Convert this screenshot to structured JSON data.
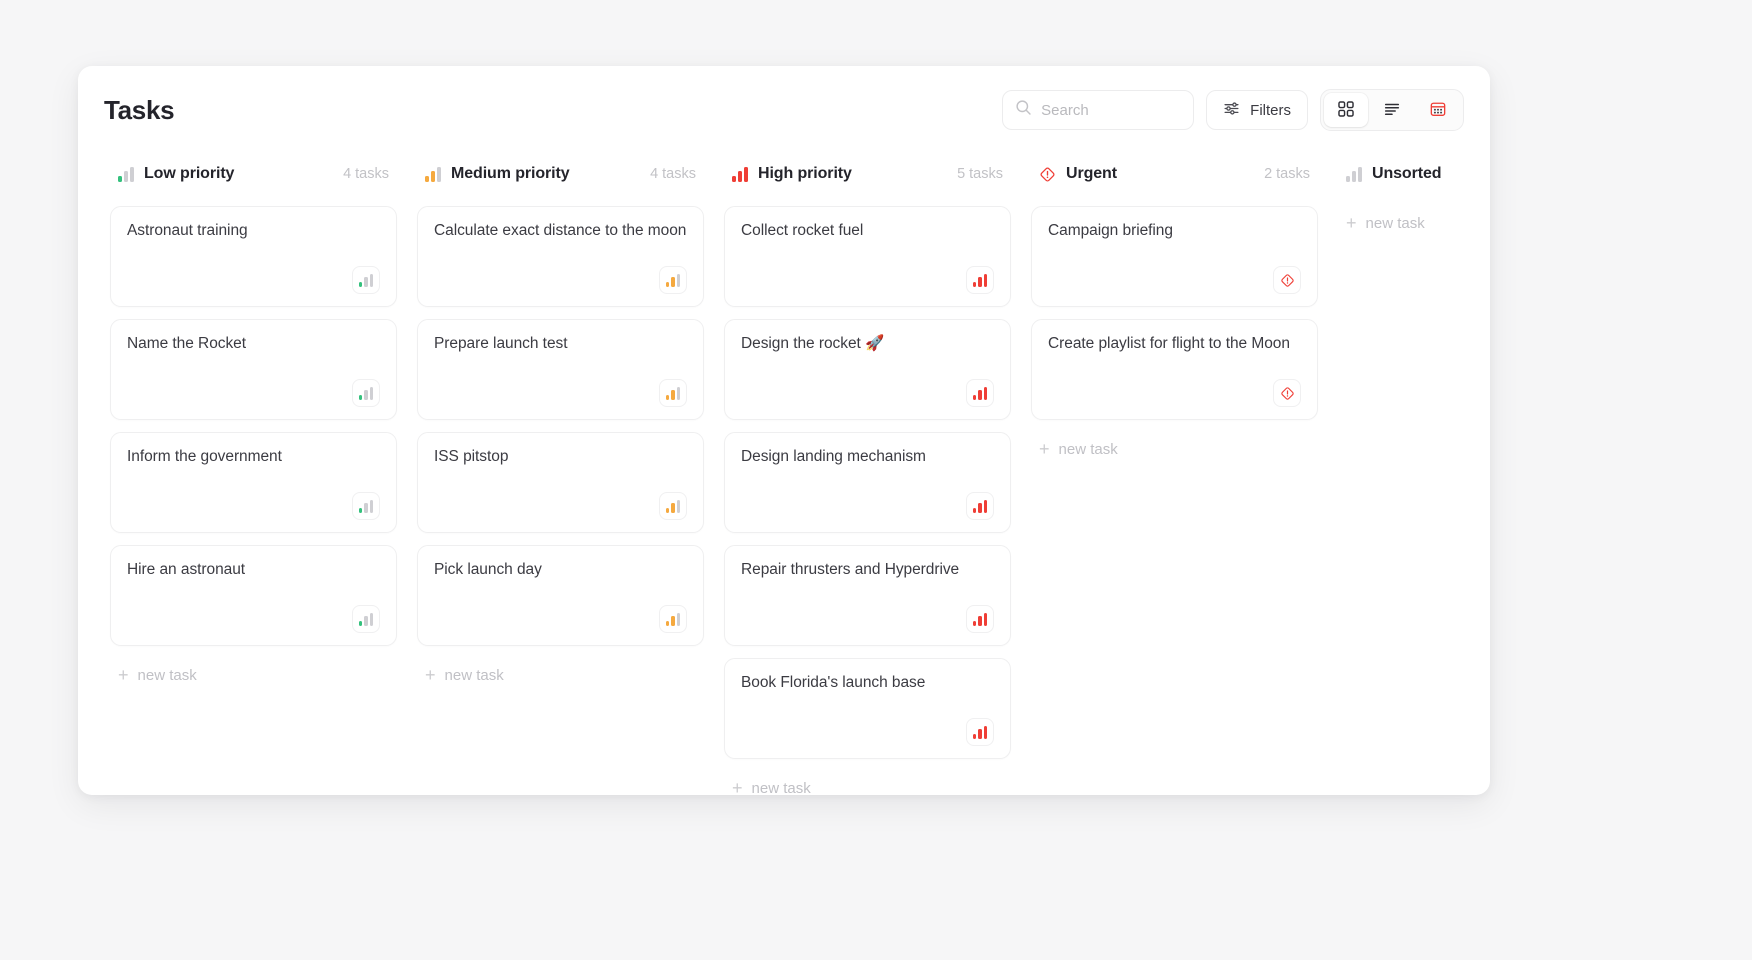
{
  "header": {
    "title": "Tasks",
    "search": {
      "placeholder": "Search",
      "value": "",
      "icon": "search-icon"
    },
    "filters": {
      "label": "Filters",
      "icon": "sliders-icon"
    },
    "views": [
      {
        "name": "board-view",
        "icon": "grid-icon",
        "active": true
      },
      {
        "name": "list-view",
        "icon": "list-icon",
        "active": false
      },
      {
        "name": "calendar-view",
        "icon": "calendar-icon",
        "active": false
      }
    ]
  },
  "colors": {
    "low": "#34c17d",
    "medium": "#f5a93f",
    "high": "#ef3e36",
    "urgent": "#ef3e36",
    "unsorted": "#cfcfd3",
    "muted": "#c2c2c6",
    "text": "#3b3b42"
  },
  "new_task_label": "new task",
  "columns": [
    {
      "id": "low",
      "title": "Low priority",
      "count_label": "4 tasks",
      "icon": "priority-bars-low-icon",
      "level": 1,
      "cards": [
        {
          "title": "Astronaut training",
          "badge": "priority-bars-low-icon"
        },
        {
          "title": "Name the Rocket",
          "badge": "priority-bars-low-icon"
        },
        {
          "title": "Inform the government",
          "badge": "priority-bars-low-icon"
        },
        {
          "title": "Hire an astronaut",
          "badge": "priority-bars-low-icon"
        }
      ]
    },
    {
      "id": "medium",
      "title": "Medium priority",
      "count_label": "4 tasks",
      "icon": "priority-bars-medium-icon",
      "level": 2,
      "cards": [
        {
          "title": "Calculate exact distance to the moon",
          "badge": "priority-bars-medium-icon"
        },
        {
          "title": "Prepare launch test",
          "badge": "priority-bars-medium-icon"
        },
        {
          "title": "ISS pitstop",
          "badge": "priority-bars-medium-icon"
        },
        {
          "title": "Pick launch day",
          "badge": "priority-bars-medium-icon"
        }
      ]
    },
    {
      "id": "high",
      "title": "High priority",
      "count_label": "5 tasks",
      "icon": "priority-bars-high-icon",
      "level": 3,
      "cards": [
        {
          "title": "Collect rocket fuel",
          "badge": "priority-bars-high-icon"
        },
        {
          "title": "Design the rocket 🚀",
          "badge": "priority-bars-high-icon"
        },
        {
          "title": "Design landing mechanism",
          "badge": "priority-bars-high-icon"
        },
        {
          "title": "Repair thrusters and Hyperdrive",
          "badge": "priority-bars-high-icon"
        },
        {
          "title": "Book Florida's launch base",
          "badge": "priority-bars-high-icon"
        }
      ]
    },
    {
      "id": "urgent",
      "title": "Urgent",
      "count_label": "2 tasks",
      "icon": "urgent-alert-icon",
      "level": 0,
      "cards": [
        {
          "title": "Campaign briefing",
          "badge": "urgent-alert-icon"
        },
        {
          "title": "Create playlist for flight to the Moon",
          "badge": "urgent-alert-icon"
        }
      ]
    },
    {
      "id": "unsorted",
      "title": "Unsorted",
      "count_label": "",
      "icon": "priority-bars-unsorted-icon",
      "level": 0,
      "cards": []
    }
  ]
}
